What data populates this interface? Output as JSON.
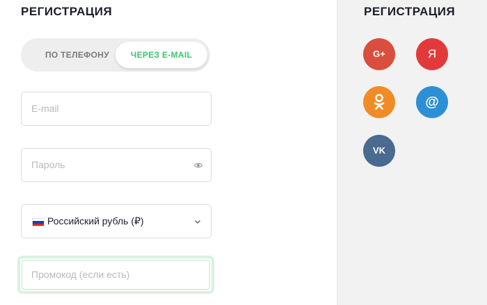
{
  "registration": {
    "title": "РЕГИСТРАЦИЯ",
    "tabs": [
      {
        "label": "ПО ТЕЛЕФОНУ",
        "active": false
      },
      {
        "label": "ЧЕРЕЗ E-MAIL",
        "active": true
      }
    ],
    "email": {
      "placeholder": "E-mail",
      "value": ""
    },
    "password": {
      "placeholder": "Пароль",
      "value": ""
    },
    "currency": {
      "selected": "Российский рубль (₽)"
    },
    "promo": {
      "placeholder": "Промокод (если есть)",
      "value": ""
    }
  },
  "social": {
    "title": "РЕГИСТРАЦИЯ",
    "buttons": [
      {
        "icon": "google-plus-icon",
        "label": "G+",
        "color": "#d94e3e"
      },
      {
        "icon": "yandex-icon",
        "label": "Я",
        "color": "#e23a3a"
      },
      {
        "icon": "odnoklassniki-icon",
        "label": "",
        "color": "#f08c25"
      },
      {
        "icon": "mail-ru-icon",
        "label": "@",
        "color": "#2d8fd5"
      },
      {
        "icon": "vk-icon",
        "label": "VK",
        "color": "#4a6a8f"
      }
    ]
  },
  "colors": {
    "accent": "#3cc46b",
    "promo_border": "#d9f2e0"
  }
}
